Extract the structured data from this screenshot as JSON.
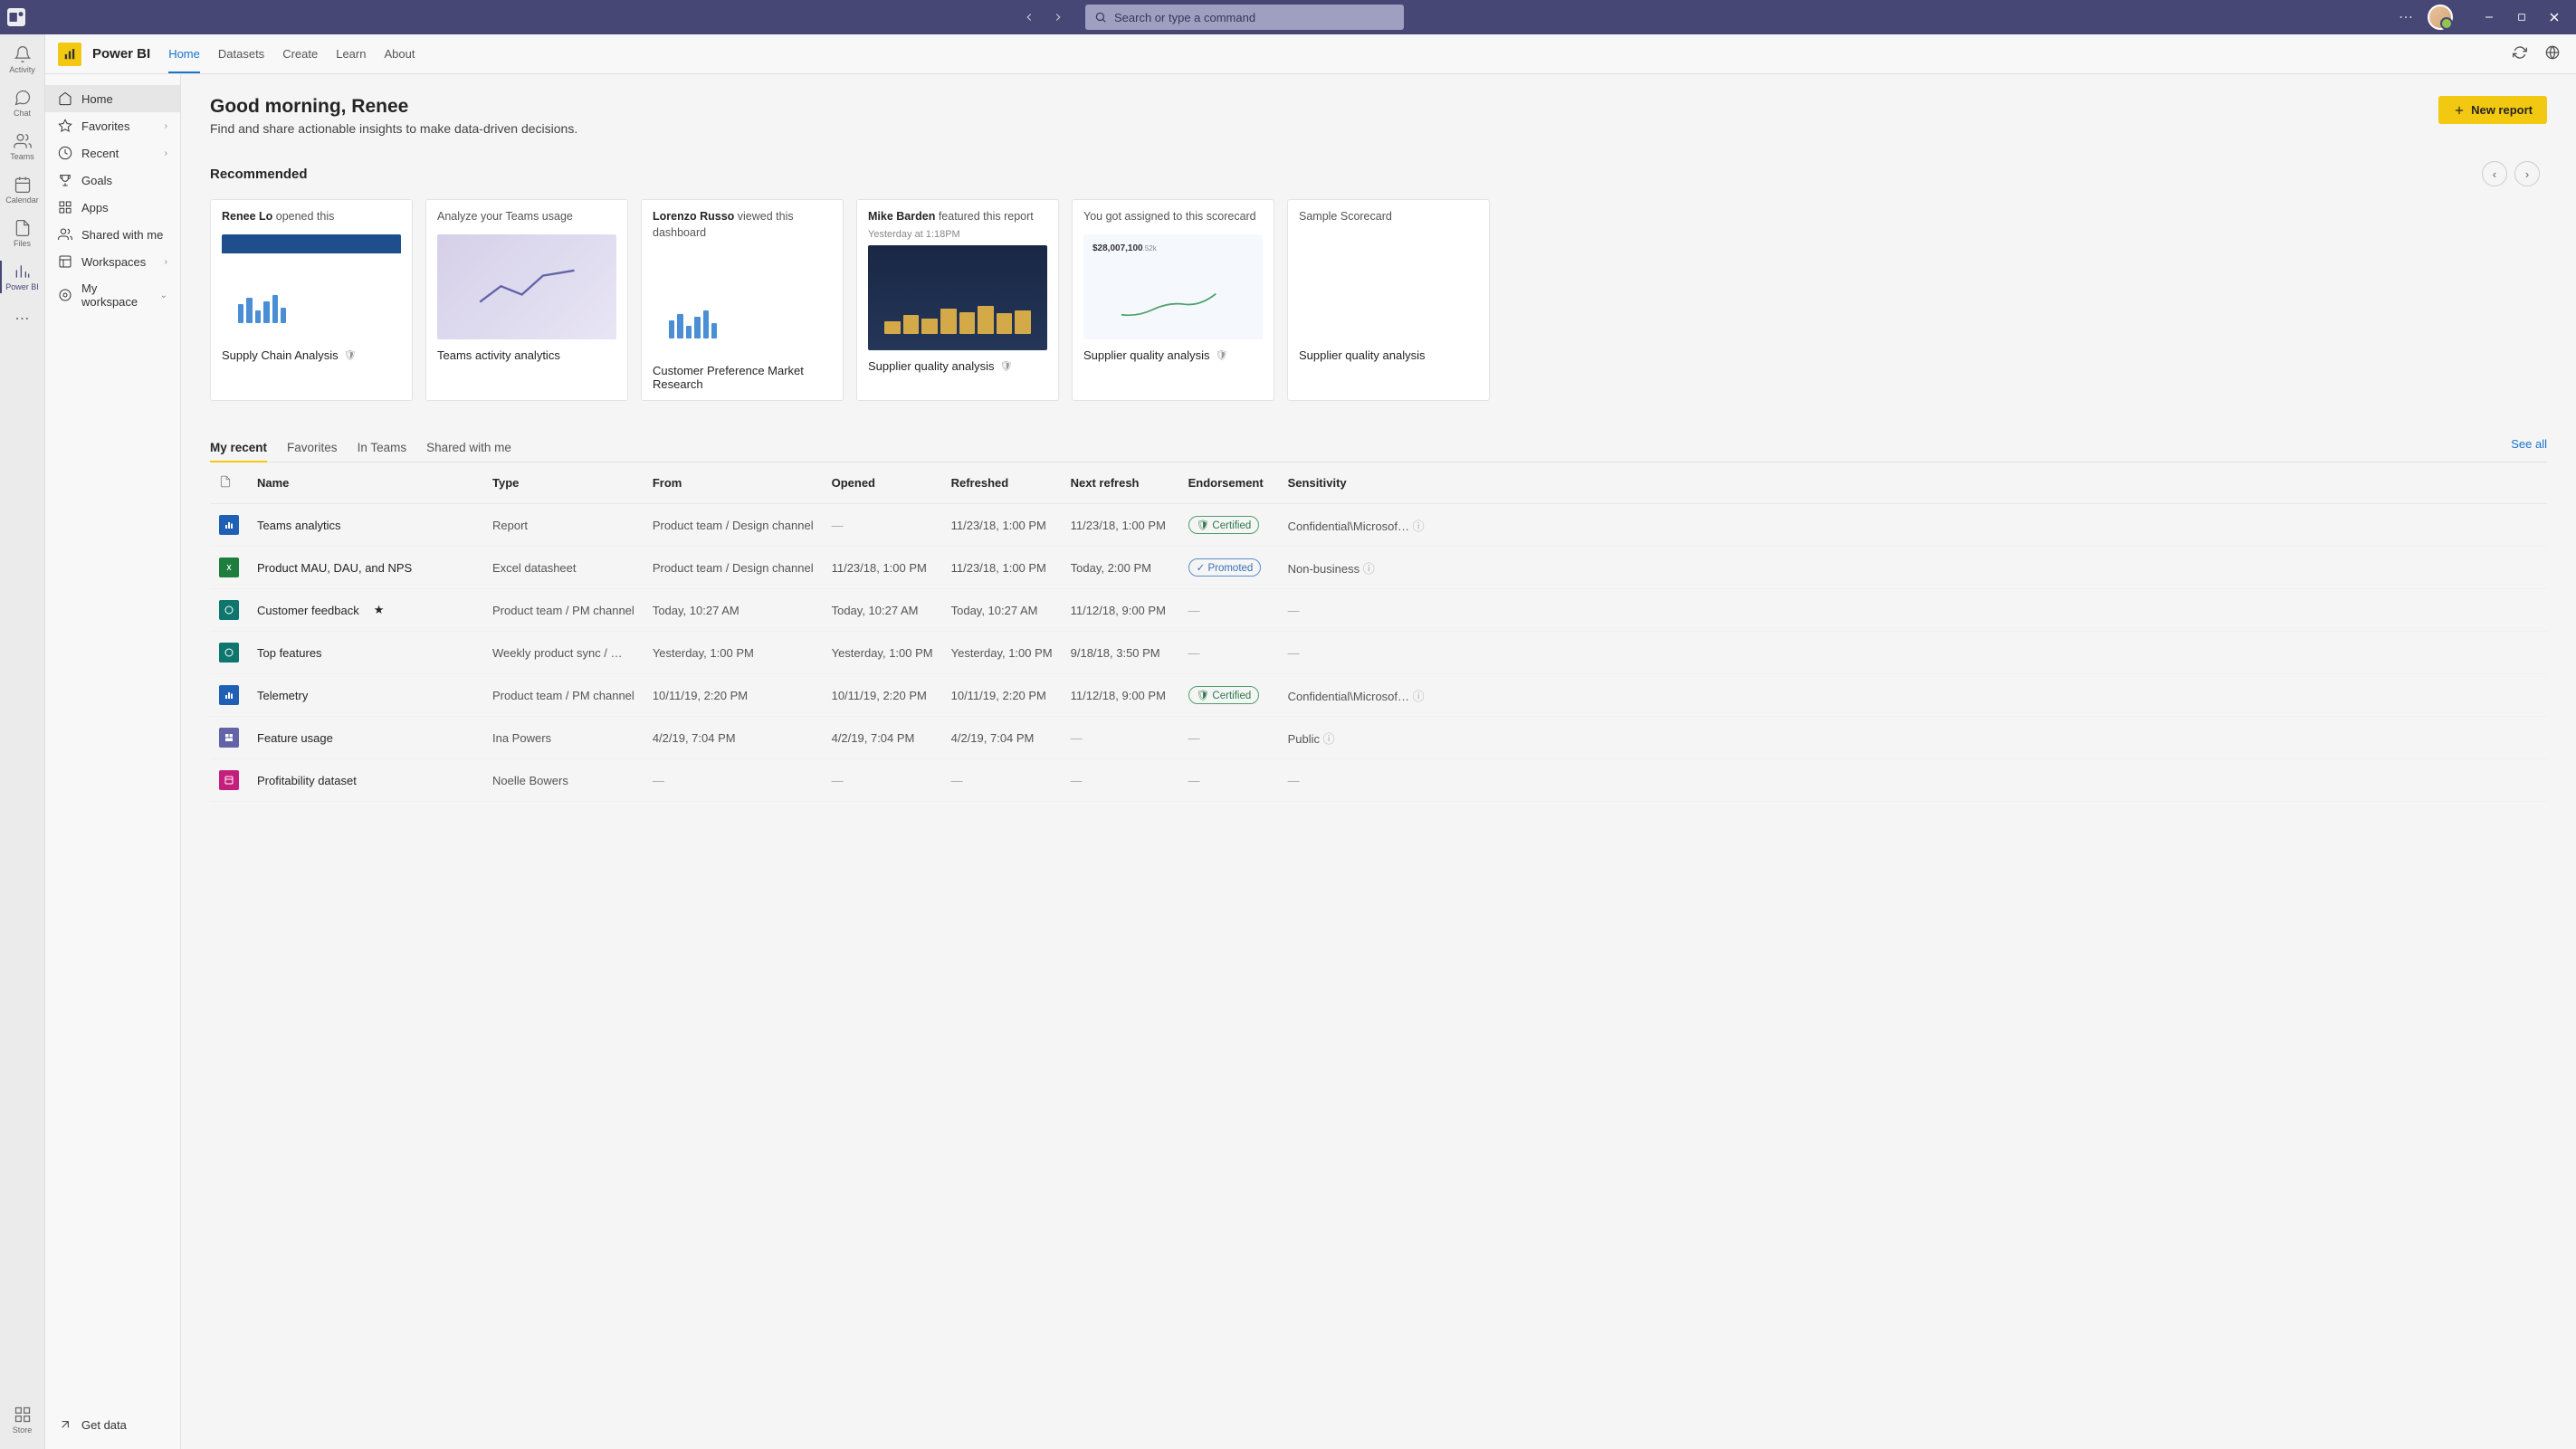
{
  "titlebar": {
    "search_placeholder": "Search or type a command"
  },
  "rail": {
    "items": [
      {
        "label": "Activity"
      },
      {
        "label": "Chat"
      },
      {
        "label": "Teams"
      },
      {
        "label": "Calendar"
      },
      {
        "label": "Files"
      },
      {
        "label": "Power BI"
      }
    ],
    "store": "Store"
  },
  "subnav": {
    "title": "Power BI",
    "tabs": [
      "Home",
      "Datasets",
      "Create",
      "Learn",
      "About"
    ]
  },
  "sidebar": {
    "items": [
      {
        "label": "Home"
      },
      {
        "label": "Favorites"
      },
      {
        "label": "Recent"
      },
      {
        "label": "Goals"
      },
      {
        "label": "Apps"
      },
      {
        "label": "Shared with me"
      },
      {
        "label": "Workspaces"
      },
      {
        "label": "My workspace"
      }
    ],
    "get_data": "Get data"
  },
  "main": {
    "greeting": "Good morning, Renee",
    "sub_greeting": "Find and share actionable insights to make data-driven decisions.",
    "new_report": "New report",
    "recommended": "Recommended"
  },
  "cards": [
    {
      "actor": "Renee Lo",
      "action": " opened this",
      "title": "Supply Chain Analysis"
    },
    {
      "actor": "",
      "action": "Analyze your Teams usage",
      "title": "Teams activity analytics"
    },
    {
      "actor": "Lorenzo Russo",
      "action": " viewed this dashboard",
      "title": "Customer Preference Market Research"
    },
    {
      "actor": "Mike Barden",
      "action": " featured this report",
      "sub": "Yesterday at 1:18PM",
      "title": "Supplier quality analysis"
    },
    {
      "actor": "",
      "action": "You got assigned to this scorecard",
      "title": "Supplier quality analysis"
    },
    {
      "actor": "",
      "action": "Sample Scorecard",
      "title": "Supplier quality analysis"
    }
  ],
  "tabs": {
    "items": [
      "My recent",
      "Favorites",
      "In Teams",
      "Shared with me"
    ],
    "see_all": "See all"
  },
  "table": {
    "headers": [
      "",
      "Name",
      "Type",
      "From",
      "Opened",
      "Refreshed",
      "Next refresh",
      "Endorsement",
      "Sensitivity"
    ],
    "rows": [
      {
        "name": "Teams analytics",
        "type": "Report",
        "from": "Product team / Design channel",
        "opened": "—",
        "refreshed": "11/23/18, 1:00 PM",
        "next": "11/23/18, 1:00 PM",
        "endorse": "Certified",
        "sens": "Confidential\\Microsof…",
        "ico": "report"
      },
      {
        "name": "Product MAU, DAU, and NPS",
        "type": "Excel datasheet",
        "from": "Product team / Design channel",
        "opened": "11/23/18, 1:00 PM",
        "refreshed": "11/23/18, 1:00 PM",
        "next": "Today, 2:00 PM",
        "endorse": "Promoted",
        "sens": "Non-business",
        "ico": "excel"
      },
      {
        "name": "Customer feedback",
        "star": true,
        "type": "Product team / PM channel",
        "from": "Today, 10:27 AM",
        "opened": "Today, 10:27 AM",
        "refreshed": "Today, 10:27 AM",
        "next": "11/12/18, 9:00 PM",
        "endorse": "—",
        "sens": "—",
        "ico": "teal"
      },
      {
        "name": "Top features",
        "type": "Weekly product sync / …",
        "from": "Yesterday, 1:00 PM",
        "opened": "Yesterday, 1:00 PM",
        "refreshed": "Yesterday, 1:00 PM",
        "next": "9/18/18, 3:50 PM",
        "endorse": "—",
        "sens": "—",
        "ico": "teal"
      },
      {
        "name": "Telemetry",
        "type": "Product team / PM channel",
        "from": "10/11/19, 2:20 PM",
        "opened": "10/11/19, 2:20 PM",
        "refreshed": "10/11/19, 2:20 PM",
        "next": "11/12/18, 9:00 PM",
        "endorse": "Certified",
        "sens": "Confidential\\Microsof…",
        "ico": "report"
      },
      {
        "name": "Feature usage",
        "type": "Ina Powers",
        "from": "4/2/19, 7:04 PM",
        "opened": "4/2/19, 7:04 PM",
        "refreshed": "4/2/19, 7:04 PM",
        "next": "—",
        "endorse": "—",
        "sens": "Public",
        "ico": "purple"
      },
      {
        "name": "Profitability dataset",
        "type": "Noelle Bowers",
        "from": "—",
        "opened": "—",
        "refreshed": "—",
        "next": "—",
        "endorse": "—",
        "sens": "—",
        "ico": "pink"
      }
    ]
  }
}
